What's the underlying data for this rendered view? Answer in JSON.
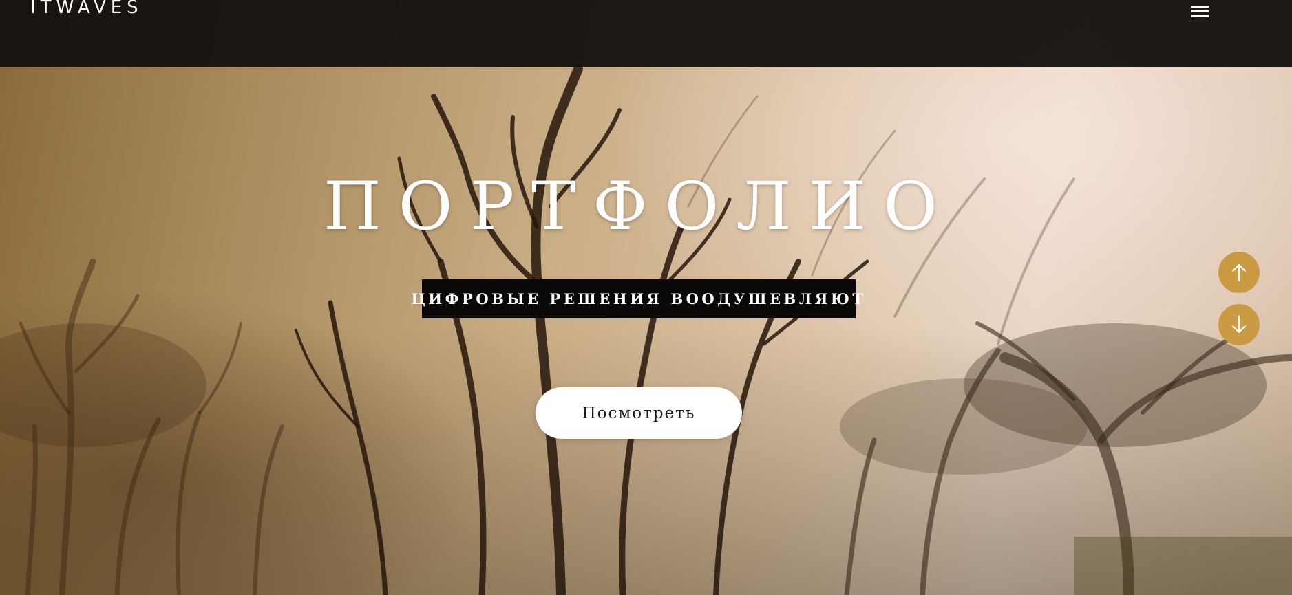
{
  "header": {
    "logo": "ITWAVES",
    "menu_icon": "hamburger-menu-icon"
  },
  "hero": {
    "title": "ПОРТФОЛИО",
    "tagline": "ЦИФРОВЫЕ РЕШЕНИЯ ВООДУШЕВЛЯЮТ",
    "cta_label": "Посмотреть"
  },
  "scroll_controls": {
    "up_icon": "arrow-up-icon",
    "down_icon": "arrow-down-icon"
  },
  "colors": {
    "header_bg": "#12100e",
    "accent": "#c99a42",
    "tagline_bg": "#0a0907",
    "button_bg": "#ffffff"
  }
}
